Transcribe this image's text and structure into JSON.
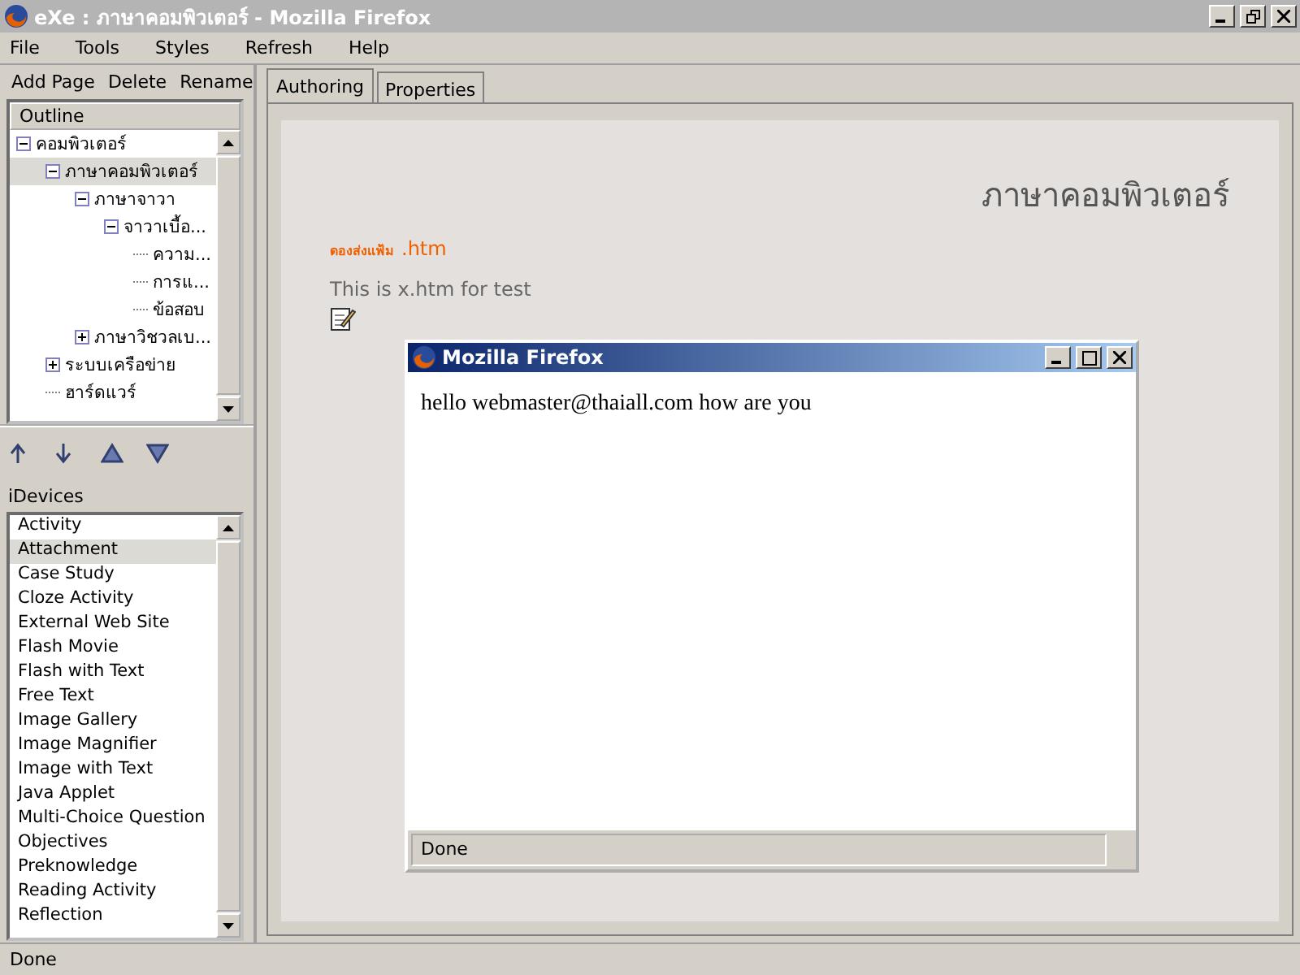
{
  "window": {
    "title": "eXe : ภาษาคอมพิวเตอร์ - Mozilla Firefox"
  },
  "menu": [
    "File",
    "Tools",
    "Styles",
    "Refresh",
    "Help"
  ],
  "page_actions": [
    "Add Page",
    "Delete",
    "Rename"
  ],
  "outline": {
    "title": "Outline",
    "tree": [
      {
        "label": "คอมพิวเตอร์",
        "expanded": true,
        "selected": false,
        "children": [
          {
            "label": "ภาษาคอมพิวเตอร์",
            "expanded": true,
            "selected": true,
            "children": [
              {
                "label": "ภาษาจาวา",
                "expanded": true,
                "selected": false,
                "children": [
                  {
                    "label": "จาวาเบื้อ...",
                    "expanded": true,
                    "selected": false,
                    "children": [
                      {
                        "label": "ความ...",
                        "selected": false
                      },
                      {
                        "label": "การแ...",
                        "selected": false
                      },
                      {
                        "label": "ข้อสอบ",
                        "selected": false
                      }
                    ]
                  }
                ]
              },
              {
                "label": "ภาษาวิชวลเบ...",
                "expanded": false,
                "selected": false
              }
            ]
          },
          {
            "label": "ระบบเครือข่าย",
            "expanded": false,
            "selected": false
          },
          {
            "label": "ฮาร์ดแวร์",
            "selected": false
          }
        ]
      }
    ]
  },
  "idevices": {
    "title": "iDevices",
    "items": [
      {
        "label": "Activity",
        "selected": false
      },
      {
        "label": "Attachment",
        "selected": true
      },
      {
        "label": "Case Study",
        "selected": false
      },
      {
        "label": "Cloze Activity",
        "selected": false
      },
      {
        "label": "External Web Site",
        "selected": false
      },
      {
        "label": "Flash Movie",
        "selected": false
      },
      {
        "label": "Flash with Text",
        "selected": false
      },
      {
        "label": "Free Text",
        "selected": false
      },
      {
        "label": "Image Gallery",
        "selected": false
      },
      {
        "label": "Image Magnifier",
        "selected": false
      },
      {
        "label": "Image with Text",
        "selected": false
      },
      {
        "label": "Java Applet",
        "selected": false
      },
      {
        "label": "Multi-Choice Question",
        "selected": false
      },
      {
        "label": "Objectives",
        "selected": false
      },
      {
        "label": "Preknowledge",
        "selected": false
      },
      {
        "label": "Reading Activity",
        "selected": false
      },
      {
        "label": "Reflection",
        "selected": false
      }
    ]
  },
  "tabs": [
    {
      "label": "Authoring",
      "selected": true
    },
    {
      "label": "Properties",
      "selected": false
    }
  ],
  "content": {
    "heading": "ภาษาคอมพิวเตอร์",
    "attachment_label": "ดองส่งแฟ้ม",
    "attachment_file": ".htm",
    "description": "This is x.htm for test"
  },
  "popup": {
    "title": "Mozilla Firefox",
    "body": "hello webmaster@thaiall.com how are you",
    "status": "Done"
  },
  "status_bar": "Done"
}
